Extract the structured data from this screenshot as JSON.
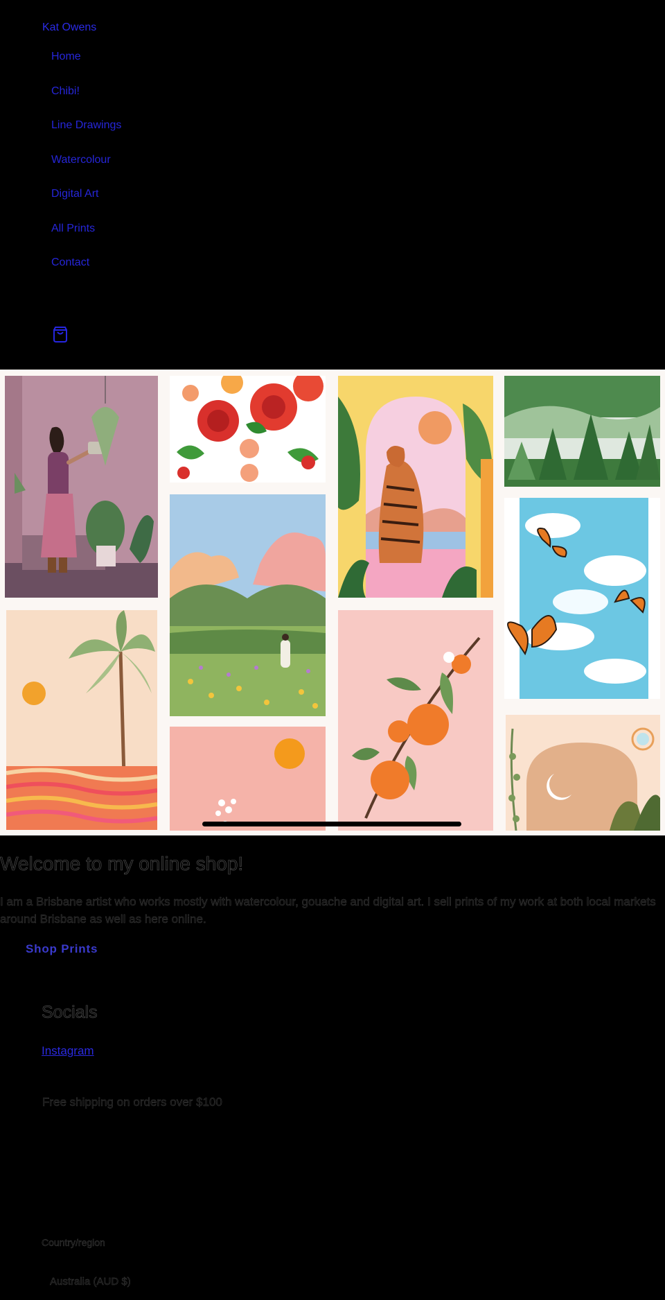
{
  "header": {
    "site_title": "Kat Owens",
    "nav": [
      {
        "label": "Home"
      },
      {
        "label": "Chibi!"
      },
      {
        "label": "Line Drawings"
      },
      {
        "label": "Watercolour"
      },
      {
        "label": "Digital Art"
      },
      {
        "label": "All Prints"
      },
      {
        "label": "Contact"
      }
    ],
    "cart_icon": "shopping-bag-icon"
  },
  "hero": {
    "artworks": [
      "woman-watering-plants",
      "red-flowers",
      "tiger-under-arch",
      "misty-pine-forest",
      "meadow-landscape",
      "butterflies-sky",
      "palm-tree-sunset",
      "orange-branch",
      "pink-sun-wildflowers",
      "moon-arch-boho"
    ]
  },
  "welcome": {
    "title": "Welcome to my online shop!",
    "text": "I am a Brisbane artist who works mostly with watercolour, gouache and digital art. I sell prints of my work at both local markets around Brisbane as well as here online.",
    "cta": "Shop Prints"
  },
  "socials": {
    "title": "Socials",
    "instagram": "Instagram"
  },
  "announcement": "Free shipping on orders over $100",
  "footer": {
    "country_label": "Country/region",
    "country_value": "Australia (AUD $)"
  },
  "colors": {
    "background": "#000000",
    "link": "#2626d9",
    "hero_bg": "#fbf7f4"
  }
}
